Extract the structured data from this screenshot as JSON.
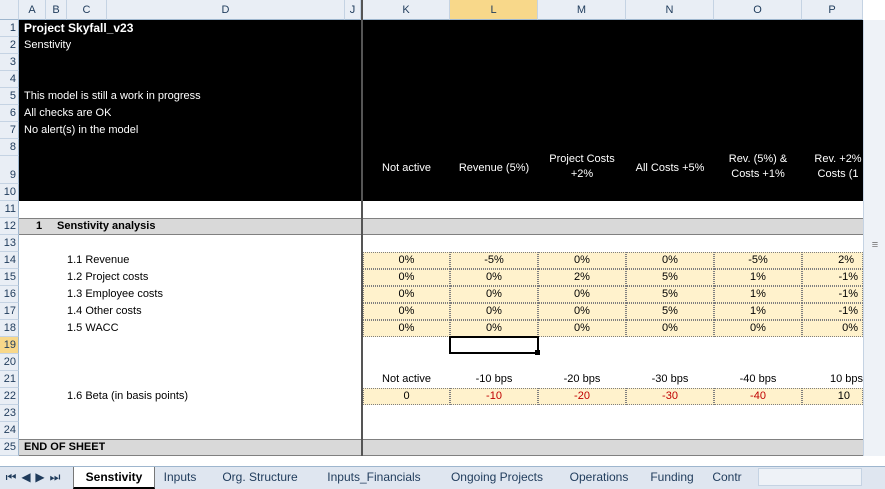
{
  "columns": [
    "A",
    "B",
    "C",
    "D",
    "J",
    "K",
    "L",
    "M",
    "N",
    "O",
    "P"
  ],
  "rows": [
    "1",
    "2",
    "3",
    "4",
    "5",
    "6",
    "7",
    "8",
    "9",
    "10",
    "11",
    "12",
    "13",
    "14",
    "15",
    "16",
    "17",
    "18",
    "19",
    "20",
    "21",
    "22",
    "23",
    "24",
    "25"
  ],
  "header": {
    "title": "Project Skyfall_v23",
    "subtitle": "Senstivity",
    "status1": "This model is still a work in progress",
    "status2": "All checks are OK",
    "status3": "No alert(s) in the model"
  },
  "scenarios": [
    "Not active",
    "Revenue (5%)",
    "Project Costs +2%",
    "All Costs +5%",
    "Rev. (5%) & Costs +1%",
    "Rev. +2% Costs (1"
  ],
  "section": {
    "number": "1",
    "title": "Senstivity analysis"
  },
  "table": [
    {
      "label": "1.1 Revenue",
      "values": [
        "0%",
        "-5%",
        "0%",
        "0%",
        "-5%",
        "2%"
      ]
    },
    {
      "label": "1.2 Project costs",
      "values": [
        "0%",
        "0%",
        "2%",
        "5%",
        "1%",
        "-1%"
      ]
    },
    {
      "label": "1.3 Employee costs",
      "values": [
        "0%",
        "0%",
        "0%",
        "5%",
        "1%",
        "-1%"
      ]
    },
    {
      "label": "1.4 Other costs",
      "values": [
        "0%",
        "0%",
        "0%",
        "5%",
        "1%",
        "-1%"
      ]
    },
    {
      "label": "1.5 WACC",
      "values": [
        "0%",
        "0%",
        "0%",
        "0%",
        "0%",
        "0%"
      ]
    }
  ],
  "beta": {
    "headers": [
      "Not active",
      "-10 bps",
      "-20 bps",
      "-30 bps",
      "-40 bps",
      "10 bps"
    ],
    "label": "1.6 Beta (in basis points)",
    "values": [
      "0",
      "-10",
      "-20",
      "-30",
      "-40",
      "10"
    ]
  },
  "end_label": "END OF SHEET",
  "tabs": [
    "Senstivity",
    "Inputs",
    "Org. Structure",
    "Inputs_Financials",
    "Ongoing Projects",
    "Operations",
    "Funding",
    "Contr"
  ]
}
